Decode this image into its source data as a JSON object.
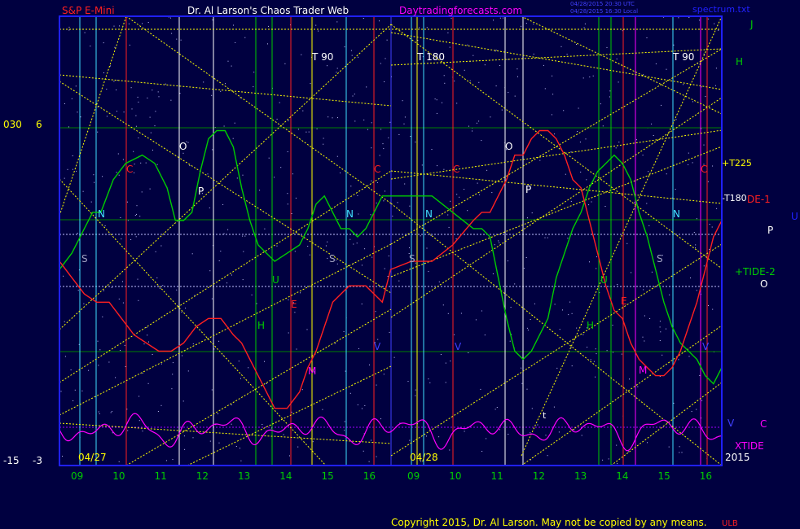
{
  "header": {
    "symbol": "S&P E-Mini",
    "author": "Dr. Al Larson's Chaos Trader Web",
    "site": "Daytradingforecasts.com",
    "stamp1": "04/28/2015 20:30 UTC",
    "stamp2": "04/28/2015 16:30 Local",
    "file": "spectrum.txt"
  },
  "footer": {
    "copyright": "Copyright 2015, Dr. Al Larson. May not be copied by any means.",
    "mark": "ULB"
  },
  "colors": {
    "bg": "#000040",
    "green": "#00cc00",
    "red": "#ff2020",
    "magenta": "#ff00ff",
    "yellow": "#ffff00",
    "cyan": "#40e0ff",
    "white": "#ffffff",
    "blue": "#2020ff"
  },
  "chart_data": {
    "type": "line",
    "dates": [
      "04/27",
      "04/28"
    ],
    "x_ticks": [
      "09",
      "10",
      "11",
      "12",
      "13",
      "14",
      "15",
      "16",
      "09",
      "10",
      "11",
      "12",
      "13",
      "14",
      "15",
      "16"
    ],
    "year": "2015",
    "left_scale": {
      "upper_a": "030",
      "upper_b": "6",
      "lower_a": "-15",
      "lower_b": "-3"
    },
    "right_labels": [
      "J",
      "H",
      "+T225",
      "-T180",
      "DE-1",
      "U",
      "P",
      "+TIDE-2",
      "O",
      "V",
      "C",
      "XTIDE"
    ],
    "time_windows": [
      "T  90",
      "T  180",
      "T  90"
    ],
    "flux_labels_day1": [
      "N",
      "S",
      "O",
      "P",
      "C",
      "H",
      "U",
      "E",
      "V",
      "M",
      "N",
      "S",
      "C"
    ],
    "flux_labels_day2": [
      "N",
      "S",
      "V",
      "C",
      "O",
      "P",
      "U",
      "H",
      "E",
      "M",
      "N",
      "S",
      "C",
      "V"
    ],
    "small_label": "t",
    "series": [
      {
        "name": "+TIDE-2",
        "color": "#00cc00",
        "x": [
          0,
          0.3,
          0.6,
          0.8,
          1,
          1.3,
          1.6,
          2,
          2.3,
          2.6,
          2.8,
          3,
          3.2,
          3.4,
          3.6,
          3.8,
          4,
          4.2,
          4.4,
          4.6,
          4.8,
          5,
          5.2,
          5.5,
          5.8,
          6,
          6.2,
          6.4,
          6.6,
          6.8,
          7,
          7.2,
          7.4,
          7.6,
          7.8,
          8,
          8.5,
          9,
          9.5,
          10,
          10.2,
          10.4,
          10.6,
          10.8,
          11,
          11.2,
          11.4,
          11.6,
          11.8,
          12,
          12.2,
          12.4,
          12.6,
          12.8,
          13,
          13.2,
          13.4,
          13.6,
          13.8,
          14,
          14.2,
          14.4,
          14.6,
          14.8,
          15,
          15.2,
          15.4,
          15.6,
          15.8,
          16
        ],
        "y": [
          44,
          46,
          49,
          51,
          51,
          55,
          57,
          58,
          57,
          54,
          50,
          50,
          51,
          56,
          60,
          61,
          61,
          59,
          54,
          50,
          47,
          46,
          45,
          46,
          47,
          49,
          52,
          53,
          51,
          49,
          49,
          48,
          49,
          51,
          53,
          53,
          53,
          53,
          51,
          49,
          49,
          48,
          43,
          38,
          34,
          33,
          34,
          36,
          38,
          43,
          46,
          49,
          51,
          54,
          56,
          57,
          58,
          57,
          55,
          51,
          48,
          44,
          40,
          37,
          35,
          34,
          33,
          31,
          30,
          32
        ]
      },
      {
        "name": "DE-1",
        "color": "#ff2020",
        "x": [
          0,
          0.3,
          0.6,
          0.9,
          1.2,
          1.5,
          1.8,
          2.1,
          2.4,
          2.7,
          3,
          3.3,
          3.6,
          3.9,
          4.2,
          4.4,
          4.6,
          4.8,
          5,
          5.2,
          5.5,
          5.8,
          6,
          6.2,
          6.4,
          6.6,
          6.8,
          7,
          7.2,
          7.4,
          7.6,
          7.8,
          8,
          8.5,
          9,
          9.5,
          10,
          10.2,
          10.4,
          10.6,
          10.8,
          11,
          11.2,
          11.4,
          11.6,
          11.8,
          12,
          12.2,
          12.4,
          12.6,
          12.8,
          13,
          13.2,
          13.4,
          13.6,
          13.8,
          14,
          14.2,
          14.4,
          14.6,
          14.8,
          15,
          15.2,
          15.4,
          15.6,
          15.8,
          16
        ],
        "y": [
          45,
          43,
          41,
          40,
          40,
          38,
          36,
          35,
          34,
          34,
          35,
          37,
          38,
          38,
          36,
          35,
          33,
          31,
          29,
          27,
          27,
          29,
          32,
          34,
          37,
          40,
          41,
          42,
          42,
          42,
          41,
          40,
          44,
          45,
          45,
          47,
          50,
          51,
          51,
          53,
          55,
          58,
          58,
          60,
          61,
          61,
          60,
          58,
          55,
          54,
          50,
          46,
          42,
          39,
          38,
          35,
          33,
          32,
          31,
          31,
          32,
          34,
          37,
          40,
          44,
          48,
          50
        ]
      }
    ],
    "oscillator": {
      "name": "XTIDE",
      "color": "#ff00ff"
    },
    "ylim": [
      20,
      75
    ]
  }
}
